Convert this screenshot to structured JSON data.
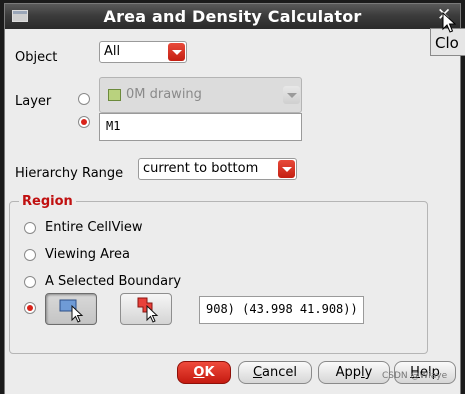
{
  "window": {
    "title": "Area and Density Calculator",
    "close_tooltip": "Clo"
  },
  "object": {
    "label": "Object",
    "value": "All"
  },
  "layer": {
    "label": "Layer",
    "combo_value": "0M drawing",
    "text_value": "M1"
  },
  "hierarchy": {
    "label": "Hierarchy Range",
    "value": "current to bottom"
  },
  "region": {
    "title": "Region",
    "options": [
      "Entire CellView",
      "Viewing Area",
      "A Selected Boundary"
    ],
    "coordinates": "908) (43.998 41.908))"
  },
  "buttons": {
    "ok": {
      "mnemonic": "O",
      "rest": "K"
    },
    "cancel": {
      "mnemonic": "C",
      "rest": "ancel"
    },
    "apply": {
      "pre": "App",
      "mnemonic": "l",
      "rest": "y"
    },
    "help": {
      "mnemonic": "H",
      "rest": "elp"
    }
  },
  "watermark": "CSDN @Wiaye",
  "colors": {
    "accent": "#d9231a",
    "title_bar": "#3c3c3c",
    "region_title": "#c01010"
  }
}
